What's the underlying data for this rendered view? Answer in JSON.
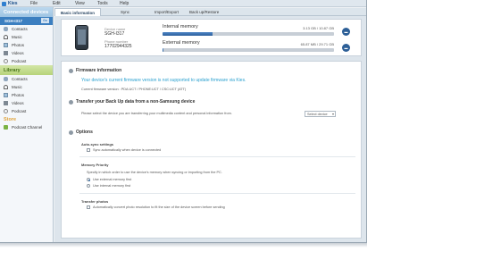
{
  "app": {
    "title": "Kies"
  },
  "menu": [
    "File",
    "Edit",
    "View",
    "Tools",
    "Help"
  ],
  "sidebar": {
    "connected_header": "Connected devices",
    "device_name": "SGH-I317",
    "device_button": "Go",
    "device_items": [
      "Contacts",
      "Music",
      "Photos",
      "Videos",
      "Podcast"
    ],
    "library_header": "Library",
    "library_items": [
      "Contacts",
      "Music",
      "Photos",
      "Videos",
      "Podcast"
    ],
    "store_header": "Store",
    "store_items": [
      "Podcast Channel"
    ]
  },
  "tabs": [
    "Basic information",
    "Sync",
    "Import/Export",
    "Back up/Restore"
  ],
  "device": {
    "name_label": "Device name",
    "name": "SGH-I317",
    "phone_label": "Phone number",
    "phone": "17702944325"
  },
  "memory": {
    "internal_label": "Internal memory",
    "internal_size": "3.13 GB / 10.87 GB",
    "internal_used_fraction": 0.29,
    "external_label": "External memory",
    "external_size": "65.87 MB / 29.71 GB",
    "external_used_fraction": 0.002
  },
  "firmware": {
    "title": "Firmware information",
    "warning": "Your device's current firmware version is not supported to update firmware via Kies.",
    "version": "Current firmware version : PDA:UCT / PHONE:UCT / CSC:UCT (ATT)"
  },
  "transfer": {
    "title": "Transfer your Back Up data from a non-Samsung device",
    "desc": "Please select the device you are transferring your multimedia content and personal information from.",
    "select": "Select device"
  },
  "options": {
    "title": "Options",
    "auto_sync_head": "Auto-sync settings",
    "auto_sync_label": "Sync automatically when device is connected",
    "memory_priority_head": "Memory Priority",
    "memory_priority_desc": "Specify in which order to use the device's memory when syncing or importing from the PC.",
    "radio_external": "Use external memory first",
    "radio_internal": "Use internal memory first",
    "transfer_photos_head": "Transfer photos",
    "transfer_photos_label": "Automatically convert photo resolution to fit the size of the device screen before sending"
  }
}
